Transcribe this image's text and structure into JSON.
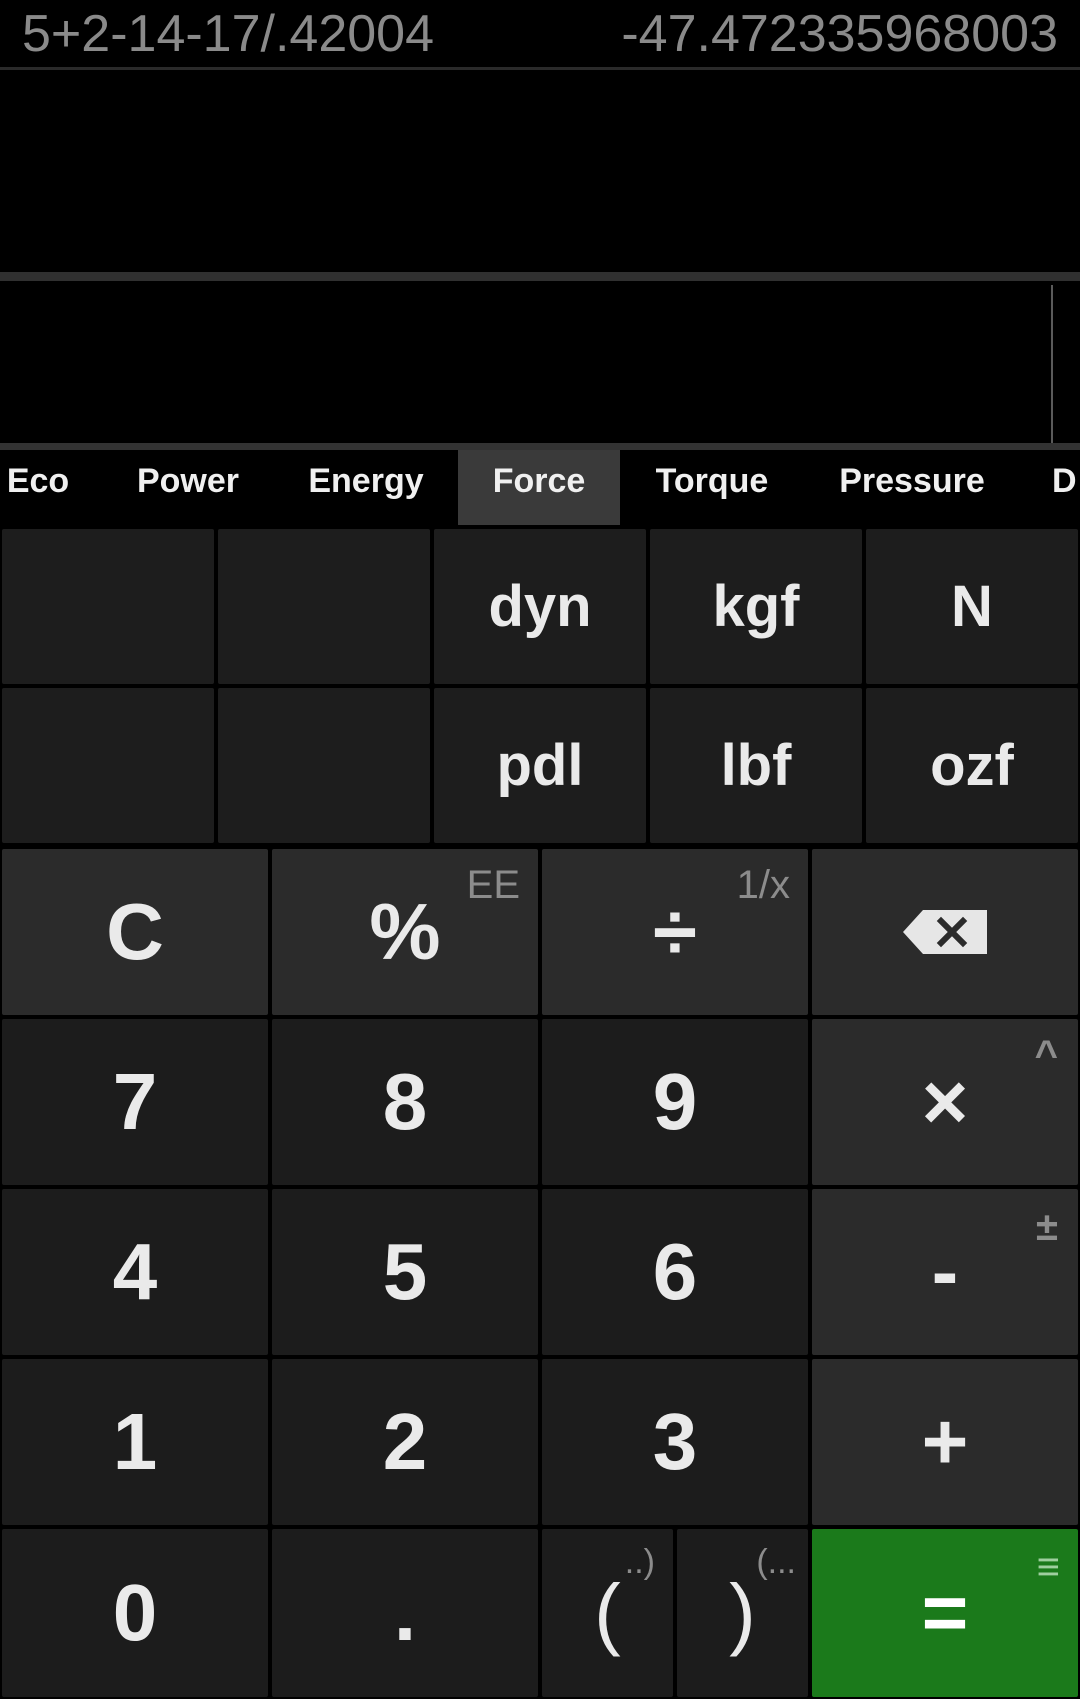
{
  "history": {
    "expression": "5+2-14-17/.42004",
    "result": "-47.472335968003"
  },
  "tabs": [
    {
      "label": "Eco"
    },
    {
      "label": "Power"
    },
    {
      "label": "Energy"
    },
    {
      "label": "Force",
      "active": true
    },
    {
      "label": "Torque"
    },
    {
      "label": "Pressure"
    },
    {
      "label": "D"
    }
  ],
  "units": {
    "row1": [
      "dyn",
      "kgf",
      "N"
    ],
    "row2": [
      "pdl",
      "lbf",
      "ozf"
    ]
  },
  "keys": {
    "clear": "C",
    "percent": "%",
    "percent_alt": "EE",
    "divide": "÷",
    "divide_alt": "1/x",
    "backspace_icon": "backspace-icon",
    "seven": "7",
    "eight": "8",
    "nine": "9",
    "multiply": "×",
    "multiply_alt": "^",
    "four": "4",
    "five": "5",
    "six": "6",
    "minus": "-",
    "minus_alt": "±",
    "one": "1",
    "two": "2",
    "three": "3",
    "plus": "+",
    "zero": "0",
    "dot": ".",
    "open_paren": "(",
    "open_paren_alt": "..)",
    "close_paren": ")",
    "close_paren_alt": "(...",
    "equals": "=",
    "equals_alt": "≡"
  },
  "colors": {
    "background": "#000000",
    "key": "#1c1c1c",
    "operator_key": "#2b2b2b",
    "equals_key": "#1b7a1b",
    "active_tab": "#3a3a3a"
  }
}
